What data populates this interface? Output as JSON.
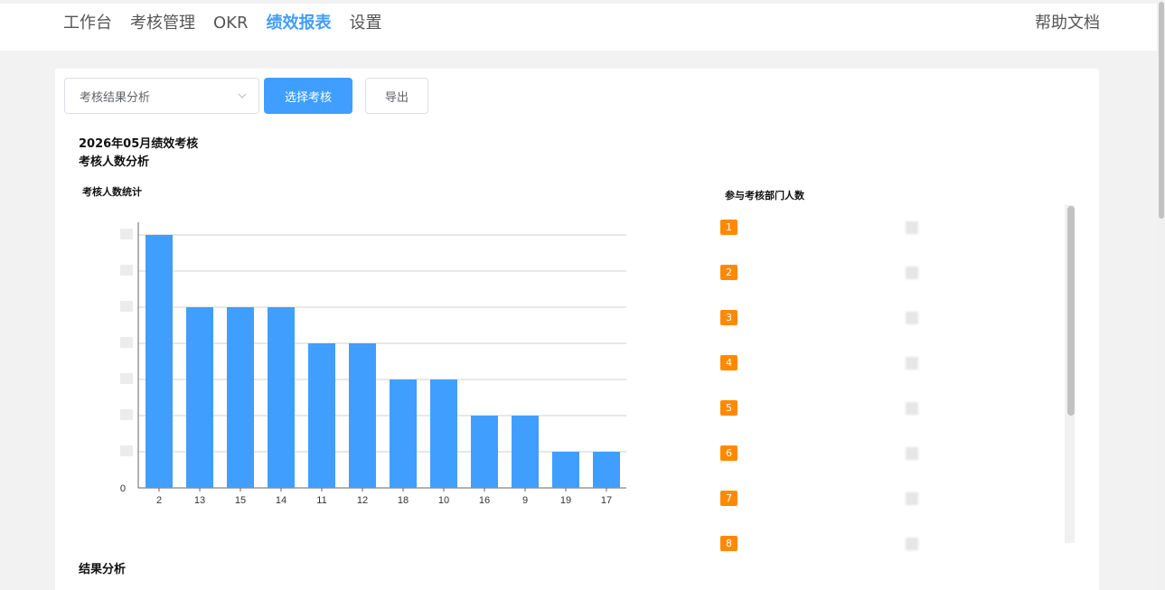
{
  "nav": {
    "items": [
      {
        "label": "工作台",
        "active": false
      },
      {
        "label": "考核管理",
        "active": false
      },
      {
        "label": "OKR",
        "active": false
      },
      {
        "label": "绩效报表",
        "active": true
      },
      {
        "label": "设置",
        "active": false
      }
    ],
    "help": "帮助文档"
  },
  "toolbar": {
    "select_value": "考核结果分析",
    "select_label": "选择考核",
    "export_label": "导出"
  },
  "report": {
    "period_title": "2026年05月绩效考核",
    "section_title": "考核人数分析",
    "chart_title": "考核人数统计",
    "result_title": "结果分析"
  },
  "ranking": {
    "title": "参与考核部门人数",
    "items": [
      "1",
      "2",
      "3",
      "4",
      "5",
      "6",
      "7",
      "8"
    ]
  },
  "colors": {
    "accent": "#409eff",
    "badge": "#ff8a00"
  },
  "chart_data": {
    "type": "bar",
    "categories": [
      "2",
      "13",
      "15",
      "14",
      "11",
      "12",
      "18",
      "10",
      "16",
      "9",
      "19",
      "17"
    ],
    "values": [
      7,
      5,
      5,
      5,
      4,
      4,
      3,
      3,
      2,
      2,
      1,
      1
    ],
    "ylim": [
      0,
      7
    ],
    "ytick_labels": [
      "0"
    ],
    "grid": true
  }
}
